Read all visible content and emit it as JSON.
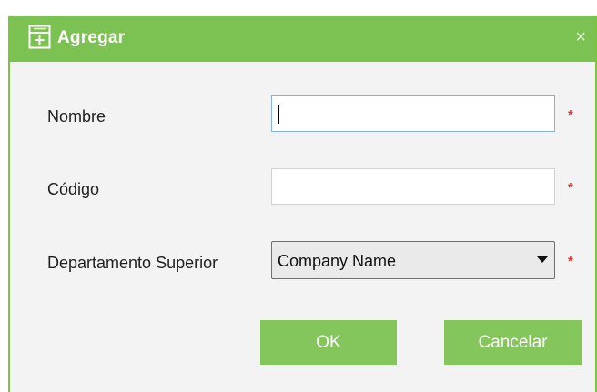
{
  "dialog": {
    "title": "Agregar",
    "close_label": "×",
    "colors": {
      "accent": "#7cc253",
      "button": "#84c65c",
      "required": "#e0332f"
    }
  },
  "form": {
    "fields": [
      {
        "label": "Nombre",
        "value": "",
        "required_mark": "*"
      },
      {
        "label": "Código",
        "value": "",
        "required_mark": "*"
      },
      {
        "label": "Departamento Superior",
        "value": "Company Name",
        "required_mark": "*"
      }
    ]
  },
  "buttons": {
    "ok_label": "OK",
    "cancel_label": "Cancelar"
  },
  "icons": {
    "title": "add-form-icon",
    "close": "close-icon",
    "dropdown": "chevron-down-icon"
  }
}
